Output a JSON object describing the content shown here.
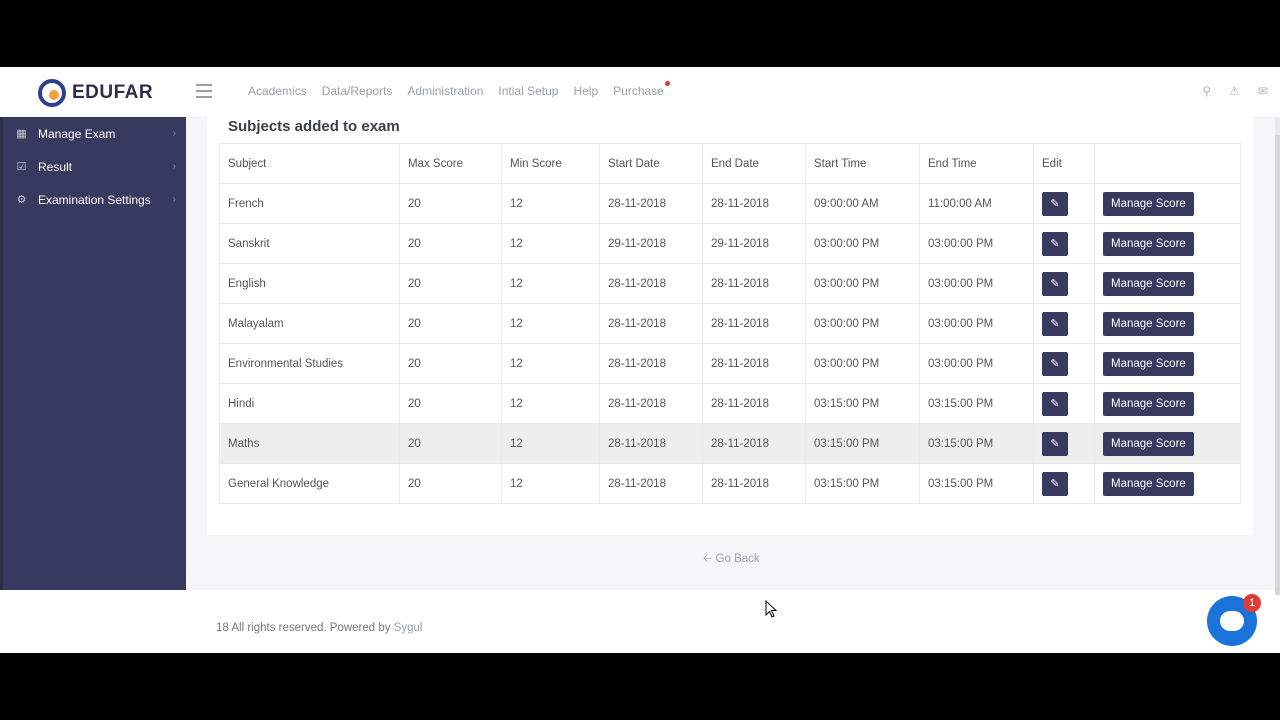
{
  "brand": {
    "name": "EDUFAR"
  },
  "nav": {
    "items": [
      "Academics",
      "Data/Reports",
      "Administration",
      "Intial Setup",
      "Help",
      "Purchase"
    ]
  },
  "top_icons": [
    "search-icon",
    "bell-icon",
    "mail-icon"
  ],
  "sidebar": {
    "items": [
      {
        "label": "Manage Exam",
        "icon": "calendar-icon"
      },
      {
        "label": "Result",
        "icon": "calendar-check-icon"
      },
      {
        "label": "Examination Settings",
        "icon": "cogs-icon"
      }
    ]
  },
  "section": {
    "title": "Subjects added to exam"
  },
  "table": {
    "headers": [
      "Subject",
      "Max Score",
      "Min Score",
      "Start Date",
      "End Date",
      "Start Time",
      "End Time",
      "Edit",
      ""
    ],
    "rows": [
      [
        "French",
        "20",
        "12",
        "28-11-2018",
        "28-11-2018",
        "09:00:00 AM",
        "11:00:00 AM"
      ],
      [
        "Sanskrit",
        "20",
        "12",
        "29-11-2018",
        "29-11-2018",
        "03:00:00 PM",
        "03:00:00 PM"
      ],
      [
        "English",
        "20",
        "12",
        "28-11-2018",
        "28-11-2018",
        "03:00:00 PM",
        "03:00:00 PM"
      ],
      [
        "Malayalam",
        "20",
        "12",
        "28-11-2018",
        "28-11-2018",
        "03:00:00 PM",
        "03:00:00 PM"
      ],
      [
        "Environmental Studies",
        "20",
        "12",
        "28-11-2018",
        "28-11-2018",
        "03:00:00 PM",
        "03:00:00 PM"
      ],
      [
        "Hindi",
        "20",
        "12",
        "28-11-2018",
        "28-11-2018",
        "03:15:00 PM",
        "03:15:00 PM"
      ],
      [
        "Maths",
        "20",
        "12",
        "28-11-2018",
        "28-11-2018",
        "03:15:00 PM",
        "03:15:00 PM"
      ],
      [
        "General Knowledge",
        "20",
        "12",
        "28-11-2018",
        "28-11-2018",
        "03:15:00 PM",
        "03:15:00 PM"
      ]
    ],
    "highlighted_row": 6,
    "manage_label": "Manage Score"
  },
  "go_back": {
    "label": "Go Back"
  },
  "footer": {
    "text": "18 All rights reserved. Powered by",
    "brand": "Sygul"
  },
  "chat": {
    "badge": "1"
  },
  "colors": {
    "sidebar": "#373a5e",
    "button": "#373a5e",
    "chat": "#1a73d9",
    "badge": "#e53935"
  }
}
